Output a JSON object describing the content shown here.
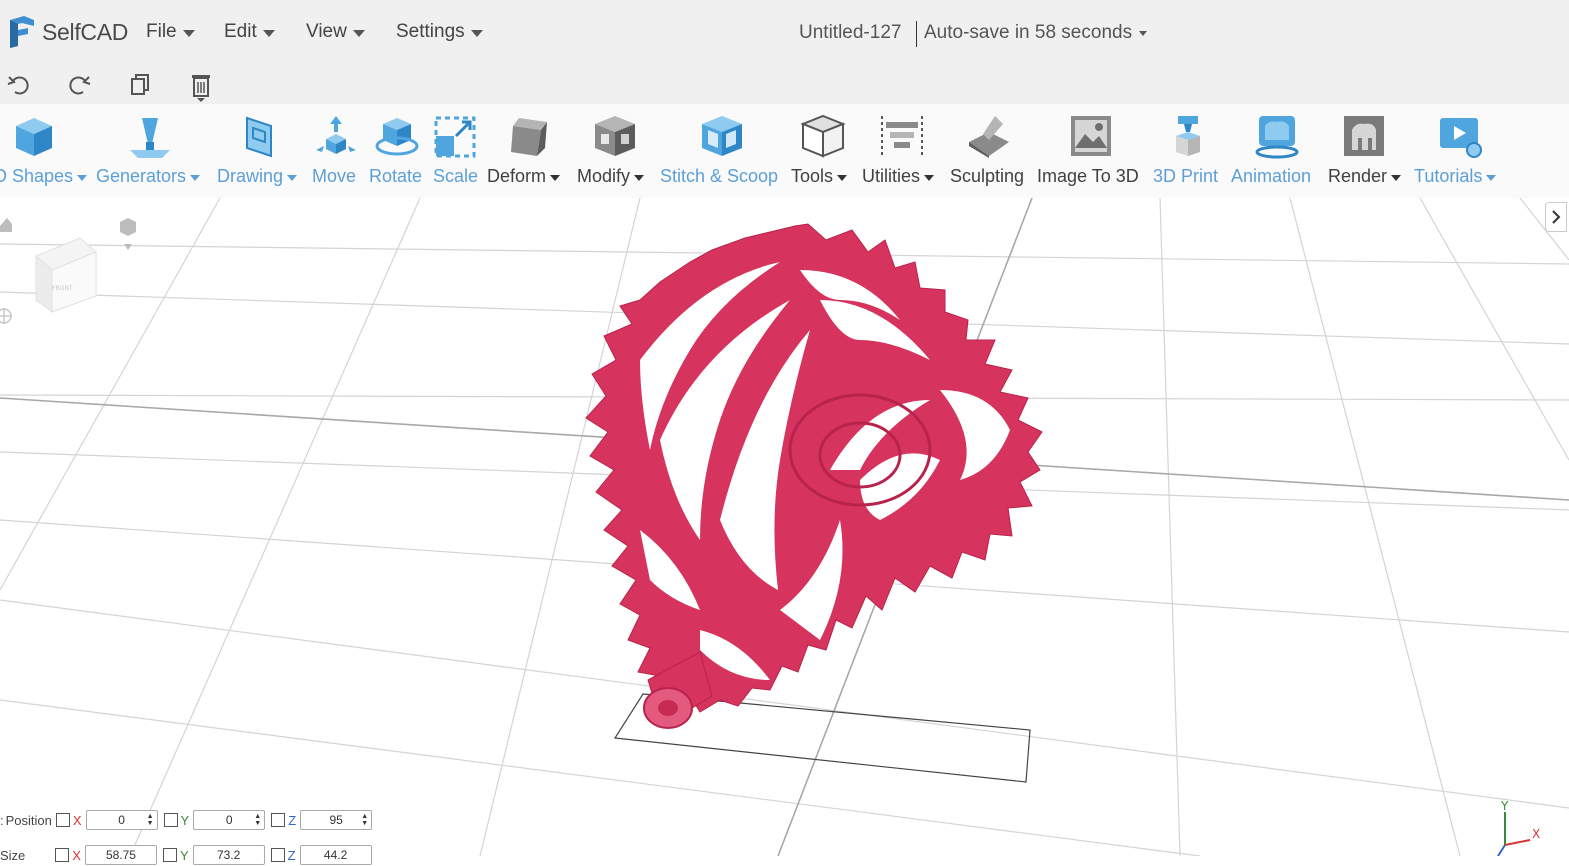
{
  "app": {
    "name": "SelfCAD"
  },
  "menu": {
    "file": "File",
    "edit": "Edit",
    "view": "View",
    "settings": "Settings"
  },
  "document": {
    "title": "Untitled-127",
    "autosave": "Auto-save in 58 seconds"
  },
  "tools": {
    "shapes": "D Shapes",
    "generators": "Generators",
    "drawing": "Drawing",
    "move": "Move",
    "rotate": "Rotate",
    "scale": "Scale",
    "deform": "Deform",
    "modify": "Modify",
    "stitch": "Stitch & Scoop",
    "tools": "Tools",
    "utilities": "Utilities",
    "sculpting": "Sculpting",
    "image3d": "Image To 3D",
    "print3d": "3D Print",
    "animation": "Animation",
    "render": "Render",
    "tutorials": "Tutorials"
  },
  "viewcube": {
    "front": "FRONT"
  },
  "properties": {
    "position_label": "Position",
    "size_label": "Size",
    "position": {
      "x": "0",
      "y": "0",
      "z": "95"
    },
    "size": {
      "x": "58.75",
      "y": "73.2",
      "z": "44.2"
    }
  },
  "axes": {
    "x": "X",
    "y": "Y",
    "z": "Z"
  },
  "colors": {
    "model": "#d6335f",
    "accent": "#5c9fd6",
    "menubar": "#f0f0f0"
  }
}
